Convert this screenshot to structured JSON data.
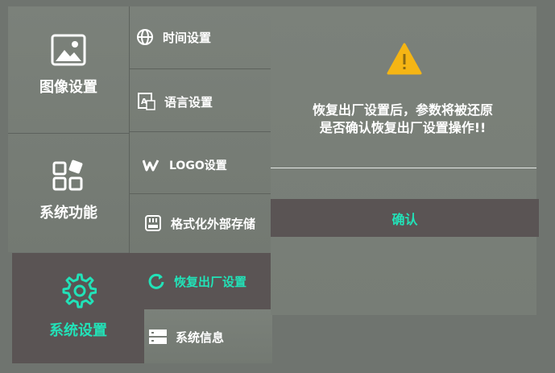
{
  "categories": [
    {
      "label": "图像设置",
      "icon": "image-icon"
    },
    {
      "label": "系统功能",
      "icon": "apps-icon"
    },
    {
      "label": "系统设置",
      "icon": "gear-icon",
      "active": true
    }
  ],
  "submenu": [
    {
      "label": "时间设置",
      "icon": "globe-icon"
    },
    {
      "label": "语言设置",
      "icon": "language-icon"
    },
    {
      "label": "LOGO设置",
      "icon": "logo-w-icon"
    },
    {
      "label": "格式化外部存储",
      "icon": "sdcard-icon"
    },
    {
      "label": "恢复出厂设置",
      "icon": "refresh-icon",
      "active": true
    },
    {
      "label": "系统信息",
      "icon": "server-icon"
    }
  ],
  "dialog": {
    "warning_icon": "warning-icon",
    "line1": "恢复出厂设置后，参数将被还原",
    "line2": "是否确认恢复出厂设置操作!!",
    "confirm_label": "确认"
  },
  "colors": {
    "accent": "#22e2b8",
    "active_bg": "#5a5454",
    "warning": "#f5b514"
  }
}
